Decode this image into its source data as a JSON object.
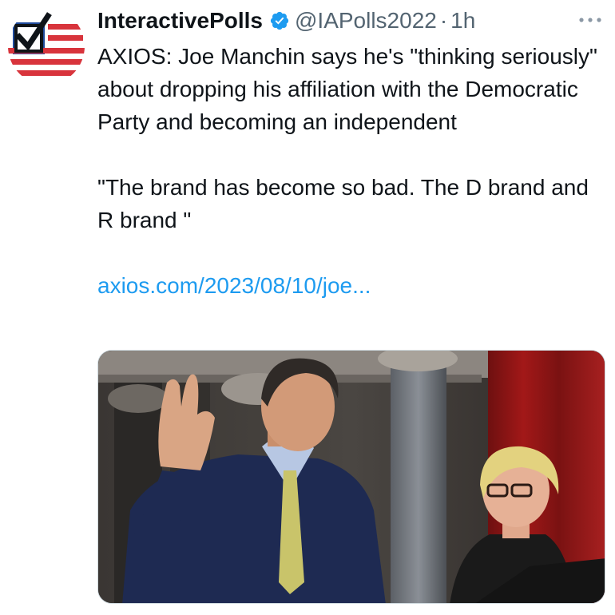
{
  "tweet": {
    "display_name": "InteractivePolls",
    "handle": "@IAPolls2022",
    "separator": "·",
    "time": "1h",
    "text_paragraphs": [
      "AXIOS: Joe Manchin says he's \"thinking seriously\" about dropping his affiliation with the Democratic Party and becoming an independent",
      "\"The brand has become so bad. The D brand and R brand \""
    ],
    "link": "axios.com/2023/08/10/joe...",
    "verified": true
  },
  "icons": {
    "avatar": "checkmark-flag-logo",
    "verified": "verified-badge-icon",
    "more": "more-options-icon"
  },
  "colors": {
    "link": "#1d9bf0",
    "verified": "#1d9bf0",
    "secondary_text": "#536471",
    "flag_red": "#d8343c",
    "flag_blue": "#1f4b9c"
  }
}
